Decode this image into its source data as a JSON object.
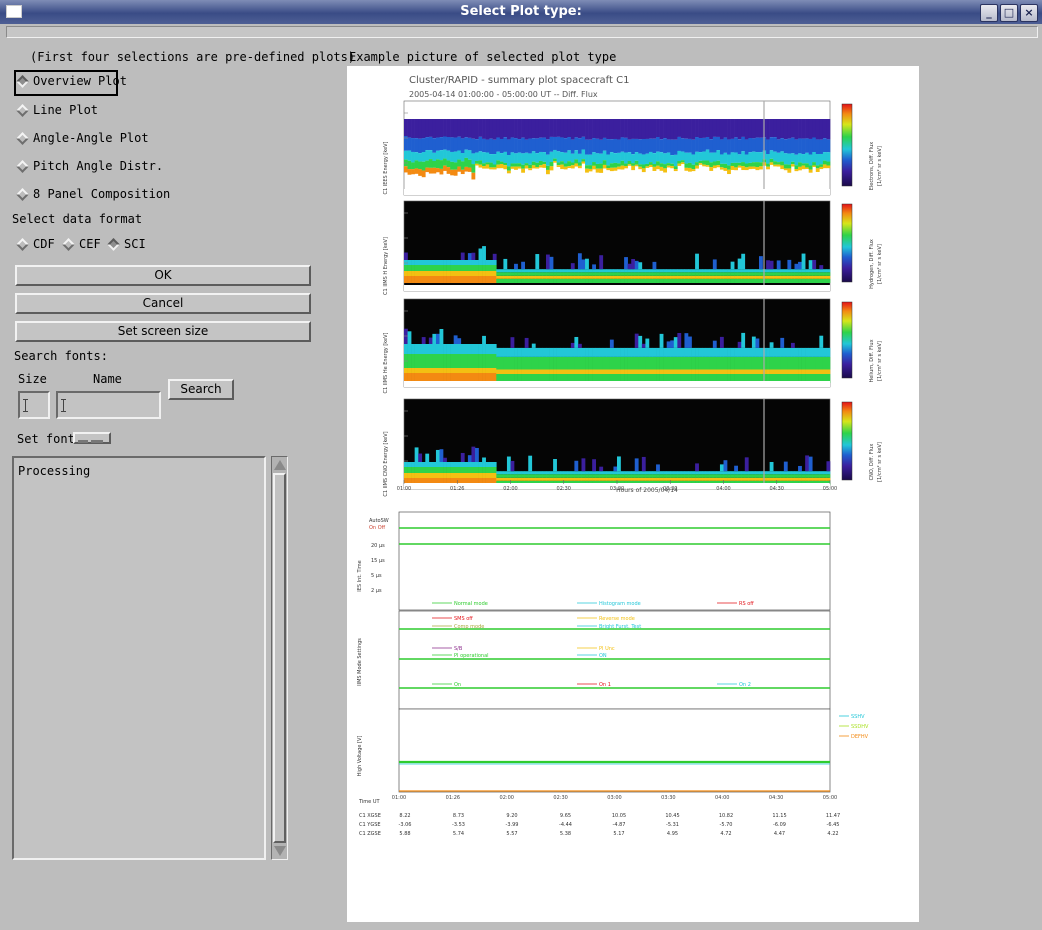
{
  "window": {
    "title": "Select Plot type:",
    "controls": [
      "_",
      "□",
      "×"
    ]
  },
  "left": {
    "hint": "(First four selections are pre-defined plots)",
    "plot_types": [
      {
        "label": "Overview Plot",
        "selected": true
      },
      {
        "label": "Line Plot",
        "selected": false
      },
      {
        "label": "Angle-Angle Plot",
        "selected": false
      },
      {
        "label": "Pitch Angle Distr.",
        "selected": false
      },
      {
        "label": "8 Panel Composition",
        "selected": false
      }
    ],
    "data_format_label": "Select data format",
    "data_formats": [
      {
        "label": "CDF",
        "selected": false
      },
      {
        "label": "CEF",
        "selected": false
      },
      {
        "label": "SCI",
        "selected": true
      }
    ],
    "ok_label": "OK",
    "cancel_label": "Cancel",
    "screen_size_label": "Set screen size",
    "search_fonts_label": "Search fonts:",
    "size_label": "Size",
    "name_label": "Name",
    "size_value": "",
    "name_value": "",
    "search_label": "Search",
    "set_font_label": "Set font",
    "log_text": "Processing"
  },
  "preview": {
    "caption": "Example picture of selected plot type",
    "plot_title": "Cluster/RAPID - summary plot spacecraft C1",
    "plot_subtitle": "2005-04-14    01:00:00 - 05:00:00 UT   --   Diff. Flux",
    "time_ticks": [
      "01:00",
      "01:26",
      "02:00",
      "02:30",
      "03:00",
      "03:30",
      "04:00",
      "04:30",
      "05:00"
    ],
    "time_axis_label": "Hours of 2005/04/14",
    "colorbar_labels": [
      "Electrons, Diff. Flux",
      "Hydrogen, Diff. Flux",
      "Helium, Diff. Flux",
      "CNO, Diff. Flux"
    ],
    "colorbar_units": "[1/cm² sr s keV]",
    "panel_ylabels": [
      "C1 IEES Energy [keV]",
      "C1 IIMS H Energy [keV]",
      "C1 IIMS He Energy [keV]",
      "C1 IIMS CNO Energy [keV]"
    ],
    "mode_panel": {
      "ylabel": "IES Int. Time",
      "labels": [
        "AutoSW",
        "On  Off"
      ],
      "levels": [
        "20 µs",
        "15 µs",
        "5 µs",
        "2 µs"
      ],
      "legend": [
        "Normal mode",
        "Histogram mode",
        "RS off"
      ]
    },
    "imms_panel": {
      "ylabel": "IIMS Mode Settings",
      "legend": [
        "SMS off",
        "Reverse mode",
        "Comp mode",
        "Bright Furst. Test",
        "S/B",
        "PI Unc",
        "PI operational",
        "ON",
        "On",
        "On 1",
        "On 2"
      ]
    },
    "hv_panel": {
      "ylabel": "High Voltage [V]",
      "legend": [
        "SSHV",
        "SSDHV",
        "DEFHV"
      ]
    },
    "ephem": {
      "header": "Time UT",
      "rows": [
        {
          "label": "C1 XGSE",
          "values": [
            "8.22",
            "8.73",
            "9.20",
            "9.65",
            "10.05",
            "10.45",
            "10.82",
            "11.15",
            "11.47"
          ]
        },
        {
          "label": "C1 YGSE",
          "values": [
            "-3.06",
            "-3.53",
            "-3.99",
            "-4.44",
            "-4.87",
            "-5.31",
            "-5.70",
            "-6.09",
            "-6.45"
          ]
        },
        {
          "label": "C1 ZGSE",
          "values": [
            "5.88",
            "5.74",
            "5.57",
            "5.38",
            "5.17",
            "4.95",
            "4.72",
            "4.47",
            "4.22"
          ]
        }
      ]
    }
  }
}
